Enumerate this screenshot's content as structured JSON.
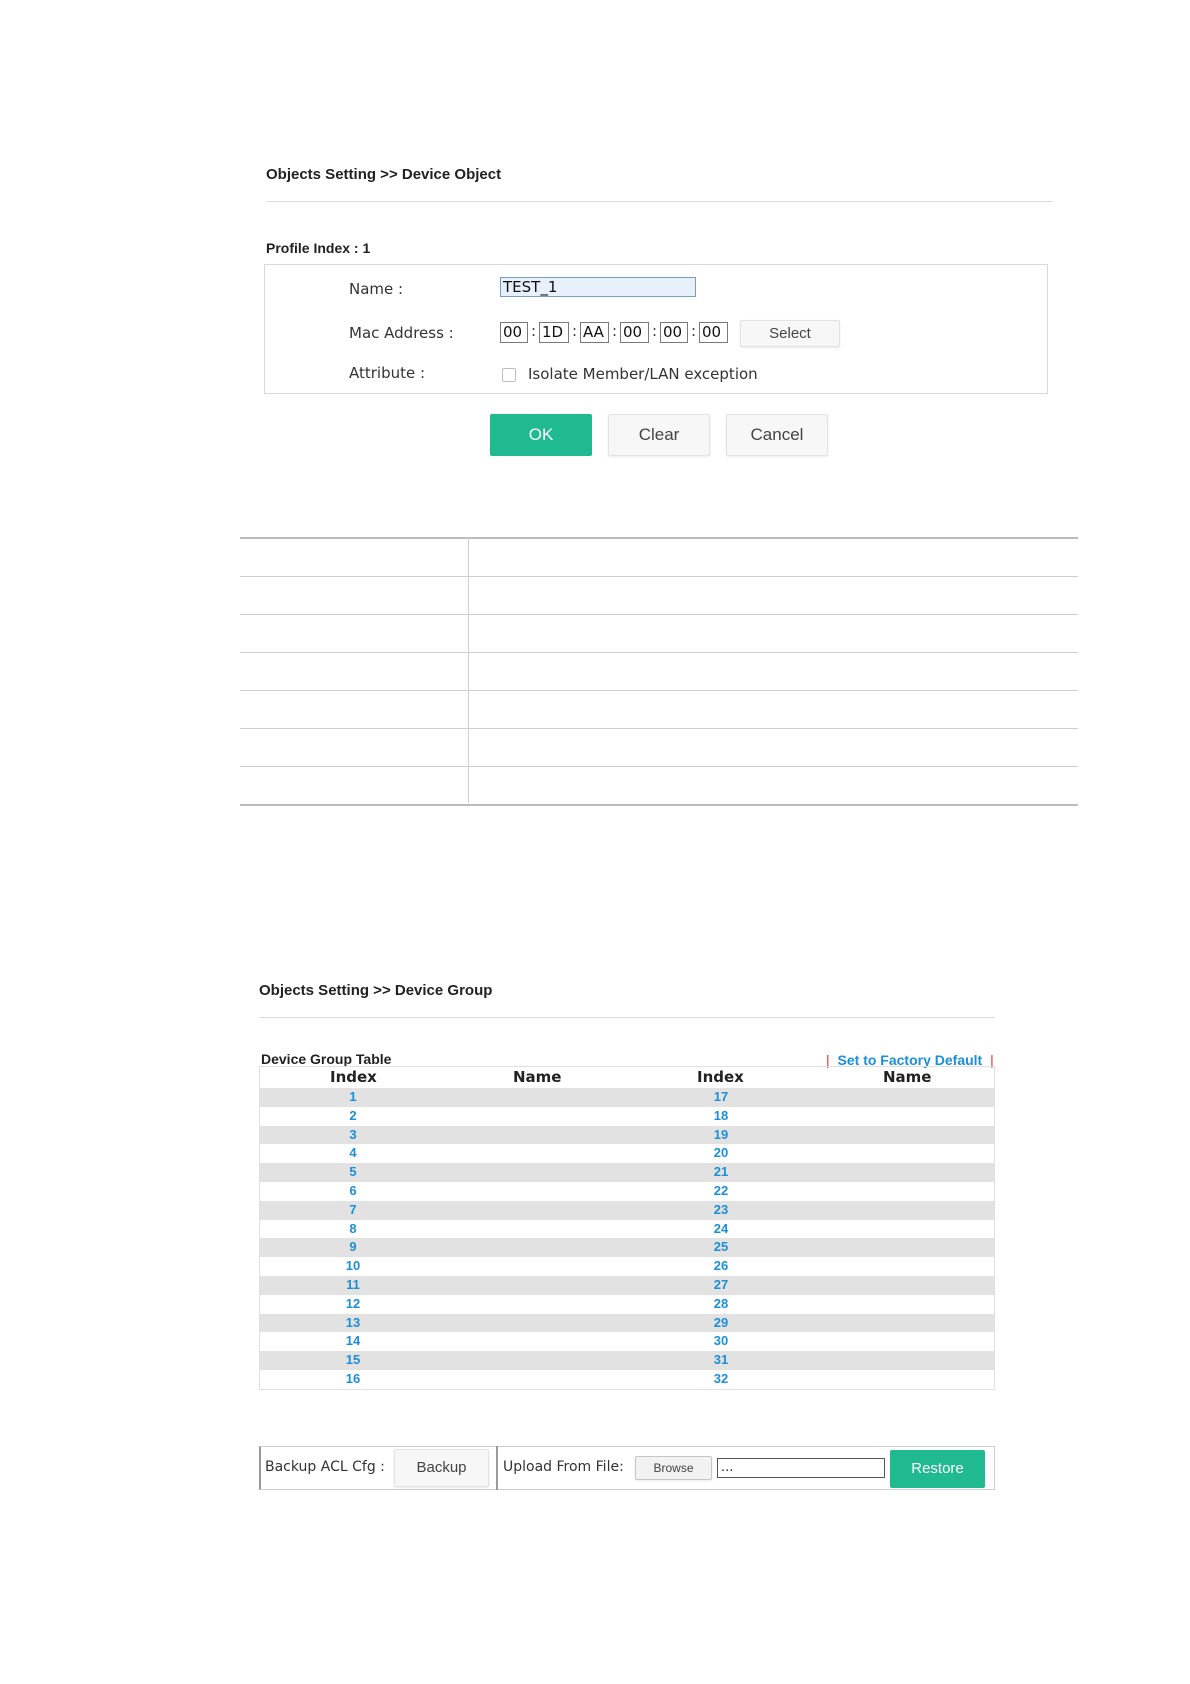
{
  "device_object": {
    "breadcrumb": "Objects Setting >> Device Object",
    "profile_label": "Profile Index : 1",
    "name_label": "Name :",
    "name_value": "TEST_1",
    "mac_label": "Mac Address :",
    "mac_octets": [
      "00",
      "1D",
      "AA",
      "00",
      "00",
      "00"
    ],
    "mac_separator": ":",
    "select_label": "Select",
    "attribute_label": "Attribute :",
    "attribute_option": "Isolate Member/LAN exception",
    "ok_label": "OK",
    "clear_label": "Clear",
    "cancel_label": "Cancel"
  },
  "device_group": {
    "breadcrumb": "Objects Setting >> Device Group",
    "table_title": "Device Group Table",
    "factory_default": "Set to Factory Default",
    "factory_bar": "|",
    "headers": {
      "index": "Index",
      "name": "Name"
    },
    "left_indices": [
      "1",
      "2",
      "3",
      "4",
      "5",
      "6",
      "7",
      "8",
      "9",
      "10",
      "11",
      "12",
      "13",
      "14",
      "15",
      "16"
    ],
    "right_indices": [
      "17",
      "18",
      "19",
      "20",
      "21",
      "22",
      "23",
      "24",
      "25",
      "26",
      "27",
      "28",
      "29",
      "30",
      "31",
      "32"
    ]
  },
  "backup": {
    "backup_label": "Backup ACL Cfg :",
    "backup_button": "Backup",
    "upload_label": "Upload From File:",
    "browse_button": "Browse",
    "file_value": "...",
    "restore_button": "Restore"
  },
  "colors": {
    "accent_green": "#1fba8f",
    "link_blue": "#1a90d8",
    "separator_red": "#e03030"
  }
}
